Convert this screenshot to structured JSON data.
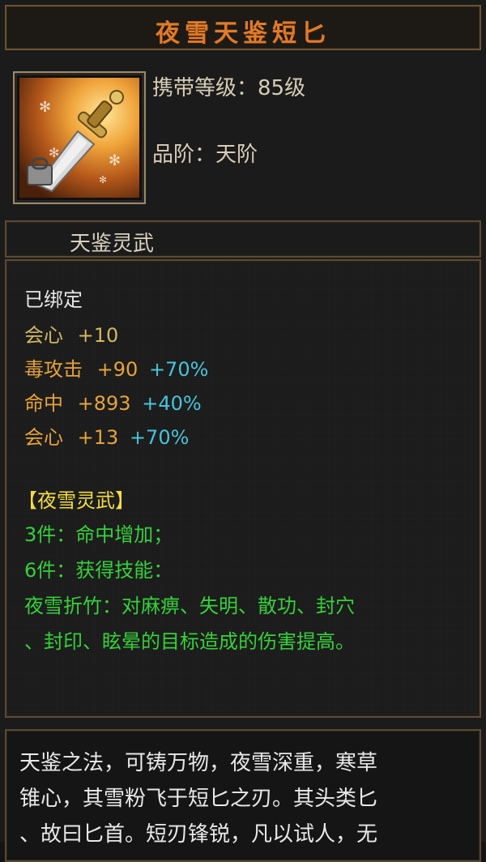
{
  "item": {
    "title": "夜雪天鉴短匕",
    "level_label": "携带等级：",
    "level_value": "85级",
    "tier_label": "品阶：",
    "tier_value": "天阶",
    "type": "天鉴灵武",
    "icon": "dagger-icon"
  },
  "stats": {
    "bound": "已绑定",
    "lines": [
      {
        "name": "会心",
        "value": "+10",
        "percent": ""
      },
      {
        "name": "毒攻击",
        "value": "+90",
        "percent": "+70%"
      },
      {
        "name": "命中",
        "value": "+893",
        "percent": "+40%"
      },
      {
        "name": "会心",
        "value": "+13",
        "percent": "+70%"
      }
    ]
  },
  "set": {
    "name": "【夜雪灵武】",
    "bonus_3": "3件：命中增加；",
    "bonus_6": "6件：获得技能：",
    "skill_line1": "夜雪折竹：对麻痹、失明、散功、封穴",
    "skill_line2": "、封印、眩晕的目标造成的伤害提高。"
  },
  "description": {
    "line1": "天鉴之法，可铸万物，夜雪深重，寒草",
    "line2": "锥心，其雪粉飞于短匕之刃。其头类匕",
    "line3": "、故曰匕首。短刃锋锐，凡以试人，无"
  },
  "colors": {
    "title": "#e07b2a",
    "stat_gold": "#d2b85e",
    "stat_orange": "#e6a33b",
    "percent_cyan": "#47c4da",
    "set_yellow": "#f2dd44",
    "set_green": "#36d13a"
  }
}
